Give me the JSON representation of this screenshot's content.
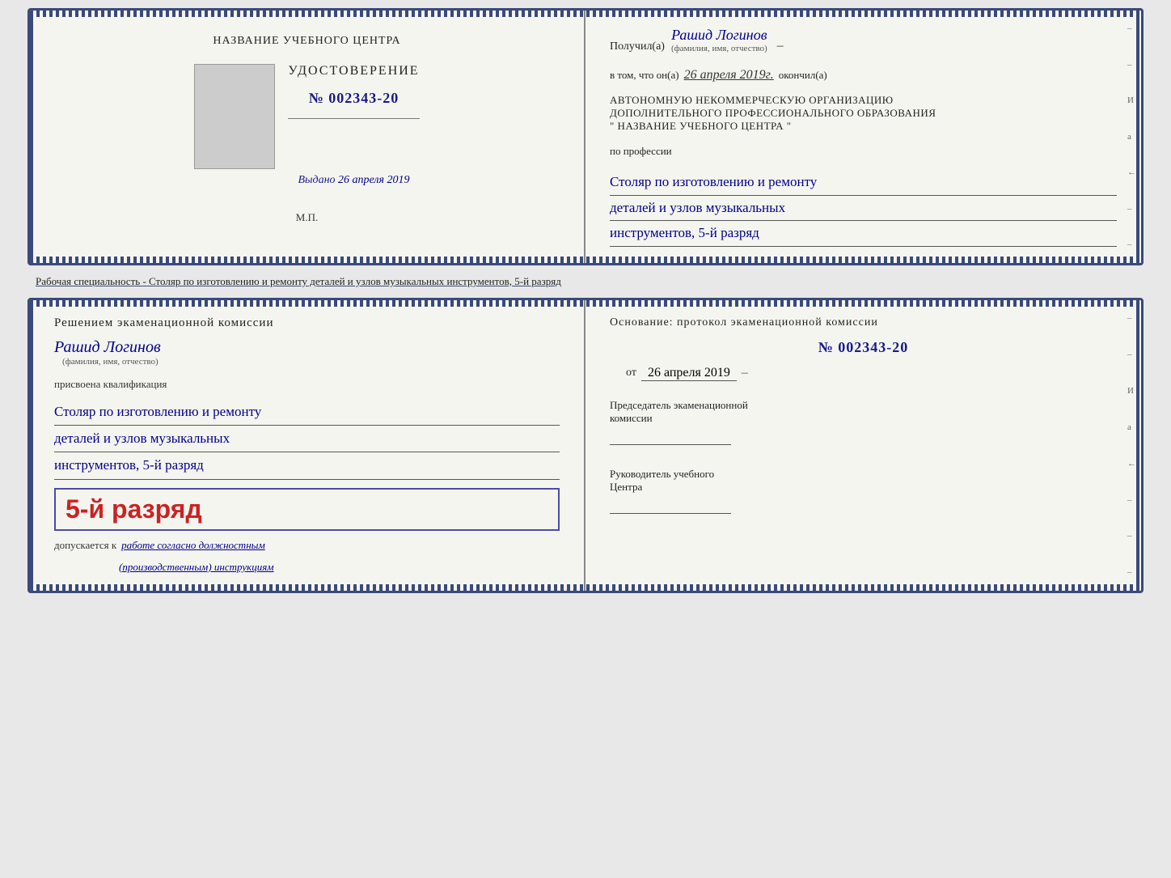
{
  "doc1": {
    "left": {
      "center_title": "НАЗВАНИЕ УЧЕБНОГО ЦЕНТРА",
      "cert_label": "УДОСТОВЕРЕНИЕ",
      "cert_number": "№ 002343-20",
      "issued_label": "Выдано",
      "issued_date": "26 апреля 2019",
      "mp": "М.П."
    },
    "right": {
      "received_label": "Получил(а)",
      "recipient_name": "Рашид Логинов",
      "fio_subtext": "(фамилия, имя, отчество)",
      "dash": "–",
      "in_that_label": "в том, что он(а)",
      "completion_date": "26 апреля 2019г.",
      "completed_label": "окончил(а)",
      "org_line1": "АВТОНОМНУЮ НЕКОММЕРЧЕСКУЮ ОРГАНИЗАЦИЮ",
      "org_line2": "ДОПОЛНИТЕЛЬНОГО ПРОФЕССИОНАЛЬНОГО ОБРАЗОВАНИЯ",
      "org_line3": "\"  НАЗВАНИЕ УЧЕБНОГО ЦЕНТРА   \"",
      "profession_label": "по профессии",
      "profession_line1": "Столяр по изготовлению и ремонту",
      "profession_line2": "деталей и узлов музыкальных",
      "profession_line3": "инструментов, 5-й разряд"
    }
  },
  "specialty_label": "Рабочая специальность - Столяр по изготовлению и ремонту деталей и узлов музыкальных инструментов, 5-й разряд",
  "doc2": {
    "left": {
      "decision_text": "Решением экаменационной комиссии",
      "person_name": "Рашид Логинов",
      "fio_subtext": "(фамилия, имя, отчество)",
      "qualification_label": "присвоена квалификация",
      "qualification_line1": "Столяр по изготовлению и ремонту",
      "qualification_line2": "деталей и узлов музыкальных",
      "qualification_line3": "инструментов, 5-й разряд",
      "rank_text": "5-й разряд",
      "допускается_label": "допускается к",
      "допускается_value": "работе согласно должностным",
      "допускается_value2": "(производственным) инструкциям"
    },
    "right": {
      "basis_label": "Основание: протокол экаменационной комиссии",
      "protocol_number": "№ 002343-20",
      "from_label": "от",
      "from_date": "26 апреля 2019",
      "chairman_line1": "Председатель экаменационной",
      "chairman_line2": "комиссии",
      "director_line1": "Руководитель учебного",
      "director_line2": "Центра"
    }
  },
  "side_marks": [
    "И",
    "а",
    "←",
    "–",
    "–",
    "–",
    "–"
  ],
  "side_marks2": [
    "И",
    "а",
    "←",
    "–",
    "–",
    "–",
    "–"
  ]
}
